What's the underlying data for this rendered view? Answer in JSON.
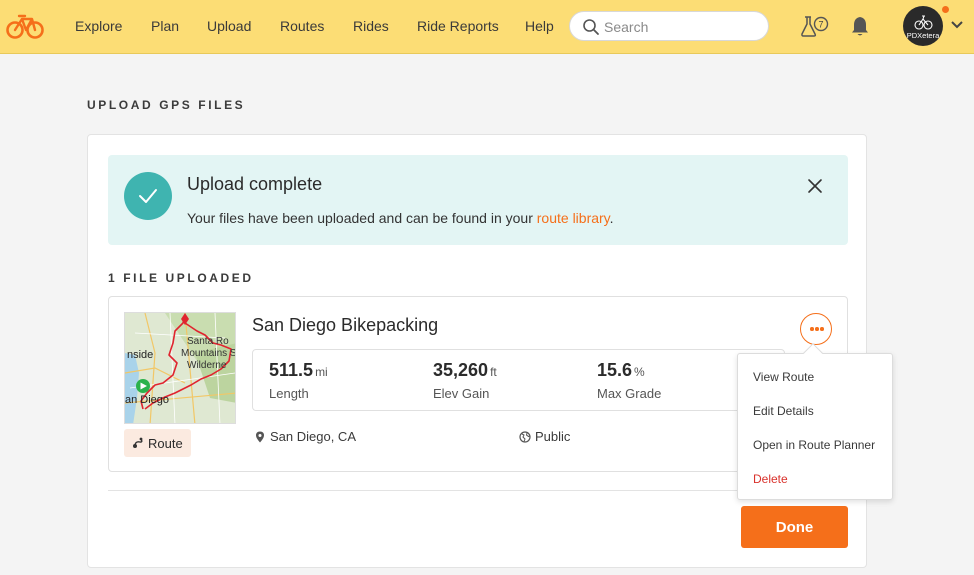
{
  "nav": {
    "items": [
      "Explore",
      "Plan",
      "Upload",
      "Routes",
      "Rides",
      "Ride Reports",
      "Help"
    ],
    "search_placeholder": "Search",
    "flask_badge": "7",
    "avatar_label": "PDXetera"
  },
  "page": {
    "heading": "UPLOAD GPS FILES"
  },
  "banner": {
    "title": "Upload complete",
    "message_prefix": "Your files have been uploaded and can be found in your ",
    "link_text": "route library",
    "message_suffix": "."
  },
  "files": {
    "heading": "1 FILE UPLOADED",
    "items": [
      {
        "name": "San Diego Bikepacking",
        "type_label": "Route",
        "location": "San Diego, CA",
        "visibility": "Public",
        "stats": [
          {
            "value": "511.5",
            "unit": "mi",
            "label": "Length"
          },
          {
            "value": "35,260",
            "unit": "ft",
            "label": "Elev Gain"
          },
          {
            "value": "15.6",
            "unit": "%",
            "label": "Max Grade"
          }
        ],
        "map_labels": [
          "Santa Ro",
          "Mountains S",
          "Wilderne",
          "nside",
          "an Diego"
        ]
      }
    ]
  },
  "context_menu": {
    "items": [
      "View Route",
      "Edit Details",
      "Open in Route Planner",
      "Delete"
    ]
  },
  "actions": {
    "done_label": "Done"
  },
  "colors": {
    "accent": "#f56f1a",
    "topbar": "#fcdd75",
    "banner_bg": "#e3f5f4",
    "success": "#3fb4b0",
    "danger": "#d9312b",
    "route_line": "#e0242f"
  }
}
